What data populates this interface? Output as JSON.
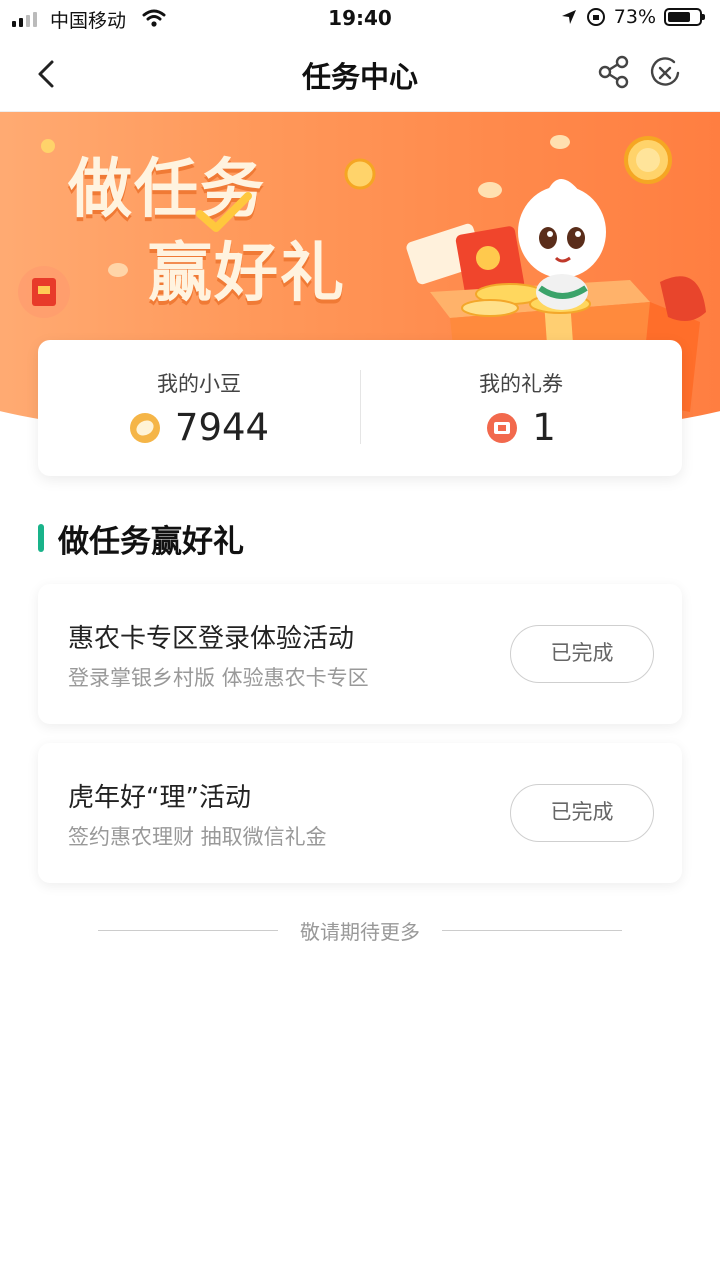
{
  "status_bar": {
    "carrier": "中国移动",
    "time": "19:40",
    "battery": "73%",
    "battery_level": 0.73
  },
  "nav": {
    "title": "任务中心",
    "back_icon": "chevron-left-icon",
    "share_icon": "share-icon",
    "close_icon": "close-circle-icon"
  },
  "banner": {
    "line1": "做任务",
    "line2": "赢好礼"
  },
  "stats": {
    "beans_label": "我的小豆",
    "beans_value": "7944",
    "coupons_label": "我的礼券",
    "coupons_value": "1"
  },
  "section": {
    "title": "做任务赢好礼"
  },
  "tasks": [
    {
      "title": "惠农卡专区登录体验活动",
      "subtitle": "登录掌银乡村版 体验惠农卡专区",
      "button": "已完成"
    },
    {
      "title": "虎年好“理”活动",
      "subtitle": "签约惠农理财 抽取微信礼金",
      "button": "已完成"
    }
  ],
  "footer": {
    "text": "敬请期待更多"
  },
  "colors": {
    "accent": "#19b38a",
    "banner": "#ff8a4c",
    "coin": "#f5b547",
    "coupon": "#f2694d"
  }
}
